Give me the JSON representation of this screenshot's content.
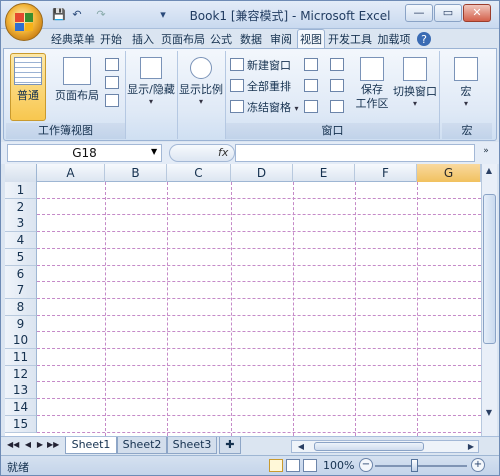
{
  "window": {
    "title": "Book1  [兼容模式] - Microsoft Excel",
    "min_label": "—",
    "max_label": "▭",
    "close_label": "✕"
  },
  "qat": {
    "save": "💾",
    "undo": "↶",
    "redo": "↷",
    "customize": "▾"
  },
  "tabs": [
    {
      "label": "经典菜单"
    },
    {
      "label": "开始"
    },
    {
      "label": "插入"
    },
    {
      "label": "页面布局"
    },
    {
      "label": "公式"
    },
    {
      "label": "数据"
    },
    {
      "label": "审阅"
    },
    {
      "label": "视图",
      "active": true
    },
    {
      "label": "开发工具"
    },
    {
      "label": "加载项"
    }
  ],
  "help_label": "?",
  "ribbon": {
    "groups": {
      "workbook_view": {
        "label": "工作簿视图",
        "normal": "普通",
        "page_layout": "页面布局"
      },
      "show_hide": {
        "label": "显示/隐藏"
      },
      "zoom": {
        "label": "显示比例"
      },
      "window": {
        "label": "窗口",
        "new_window": "新建窗口",
        "arrange_all": "全部重排",
        "freeze_panes": "冻结窗格",
        "save_workspace_line1": "保存",
        "save_workspace_line2": "工作区",
        "switch_windows": "切换窗口"
      },
      "macros": {
        "label": "宏",
        "macros": "宏"
      }
    }
  },
  "formula_bar": {
    "name_box": "G18",
    "fx": "fx",
    "formula": ""
  },
  "columns": [
    "A",
    "B",
    "C",
    "D",
    "E",
    "F",
    "G"
  ],
  "selected_column": "G",
  "rows": [
    "1",
    "2",
    "3",
    "4",
    "5",
    "6",
    "7",
    "8",
    "9",
    "10",
    "11",
    "12",
    "13",
    "14",
    "15"
  ],
  "sheets": [
    {
      "label": "Sheet1",
      "active": true
    },
    {
      "label": "Sheet2"
    },
    {
      "label": "Sheet3"
    }
  ],
  "status": {
    "ready": "就绪",
    "zoom": "100%",
    "zoom_level": 1.0
  }
}
